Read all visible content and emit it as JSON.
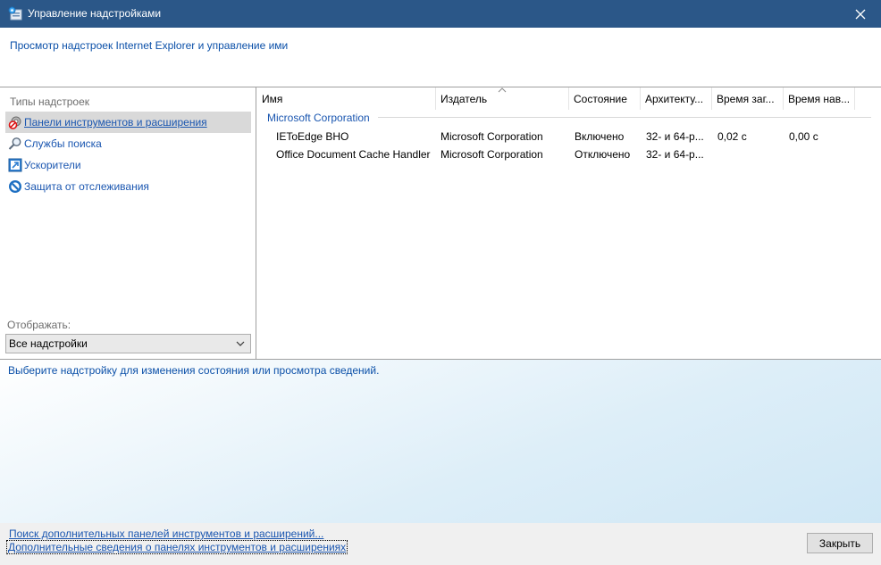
{
  "window": {
    "title": "Управление надстройками",
    "icon": "addons-manager-icon",
    "close_icon": "close-icon"
  },
  "header": {
    "subtitle": "Просмотр надстроек Internet Explorer и управление ими"
  },
  "left_pane": {
    "section_label": "Типы надстроек",
    "types": [
      {
        "label": "Панели инструментов и расширения",
        "icon": "toolbar-gear-icon",
        "selected": true
      },
      {
        "label": "Службы поиска",
        "icon": "magnifier-icon",
        "selected": false
      },
      {
        "label": "Ускорители",
        "icon": "accelerator-icon",
        "selected": false
      },
      {
        "label": "Защита от отслеживания",
        "icon": "no-entry-icon",
        "selected": false
      }
    ],
    "show_label": "Отображать:",
    "show_value": "Все надстройки"
  },
  "table": {
    "columns": [
      "Имя",
      "Издатель",
      "Состояние",
      "Архитекту...",
      "Время заг...",
      "Время нав..."
    ],
    "group": "Microsoft Corporation",
    "rows": [
      {
        "name": "IEToEdge BHO",
        "publisher": "Microsoft Corporation",
        "status": "Включено",
        "arch": "32- и 64-р...",
        "load": "0,02 с",
        "nav": "0,00 с"
      },
      {
        "name": "Office Document Cache Handler",
        "publisher": "Microsoft Corporation",
        "status": "Отключено",
        "arch": "32- и 64-р...",
        "load": "",
        "nav": ""
      }
    ]
  },
  "info": {
    "message": "Выберите надстройку для изменения состояния или просмотра сведений."
  },
  "footer": {
    "link_find": "Поиск дополнительных панелей инструментов и расширений...",
    "link_more": "Дополнительные сведения о панелях инструментов и расширениях",
    "close_label": "Закрыть"
  },
  "colors": {
    "titlebar": "#2b5788",
    "link": "#1a56b0"
  }
}
